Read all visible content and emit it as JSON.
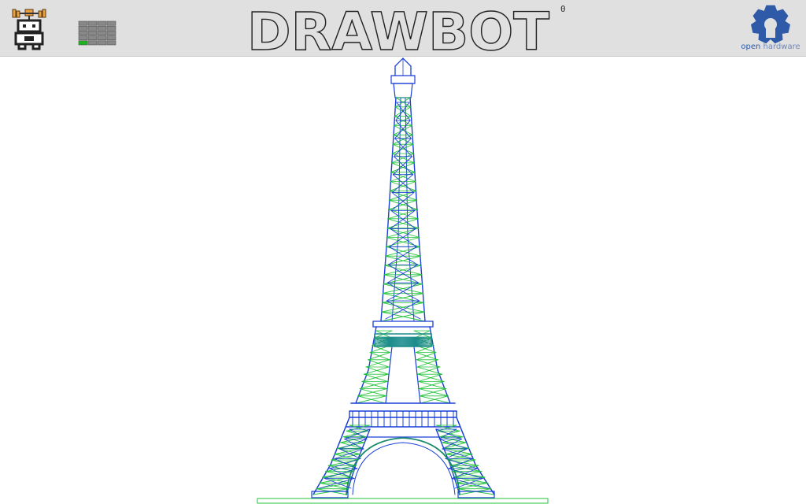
{
  "header": {
    "title": "DRAWBOT",
    "counter": "0",
    "robot_icon": "robot-icon",
    "grid_icon": "grid-icon",
    "grid_active_cell": [
      4,
      0
    ],
    "oshw": {
      "open_label": "open",
      "hardware_label": "hardware",
      "icon": "gear-icon",
      "color": "#2f5aa8"
    }
  },
  "canvas": {
    "drawing": "eiffel-tower",
    "stroke_colors": [
      "#1a3fd8",
      "#22c33a"
    ],
    "background": "#ffffff"
  }
}
